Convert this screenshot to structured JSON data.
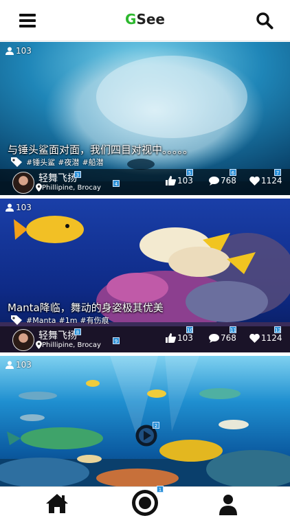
{
  "header": {
    "logo_first": "G",
    "logo_rest": "See",
    "logo_accent_color": "#2db82f"
  },
  "cards": [
    {
      "view_count": "103",
      "title": "与锤头鲨面对面，我们四目对视中。。。。。",
      "tags": [
        "#锤头鲨",
        "#夜潜",
        "#船潜"
      ],
      "author": "轻舞飞扬",
      "location": "Phillipine, Brocay",
      "likes": "103",
      "comments": "768",
      "favorites": "1124",
      "badges": {
        "author": "3",
        "meta": "4",
        "likes": "5",
        "comments": "6",
        "favorites": "7"
      }
    },
    {
      "view_count": "103",
      "title": "Manta降临，舞动的身姿极其优美",
      "tags": [
        "#Manta",
        "#1m",
        "#有伤痕"
      ],
      "author": "轻舞飞扬",
      "location": "Phillipine, Brocay",
      "likes": "103",
      "comments": "768",
      "favorites": "1124",
      "badges": {
        "author": "8",
        "meta": "9",
        "likes": "10",
        "comments": "11",
        "favorites": "12"
      }
    },
    {
      "view_count": "103",
      "badges": {
        "play": "2"
      }
    }
  ],
  "bottom_nav": {
    "camera_badge": "1",
    "items": [
      "home-icon",
      "camera-icon",
      "profile-icon"
    ]
  },
  "colors": {
    "badge": "#2a8fd6",
    "logo_green": "#2db82f"
  }
}
